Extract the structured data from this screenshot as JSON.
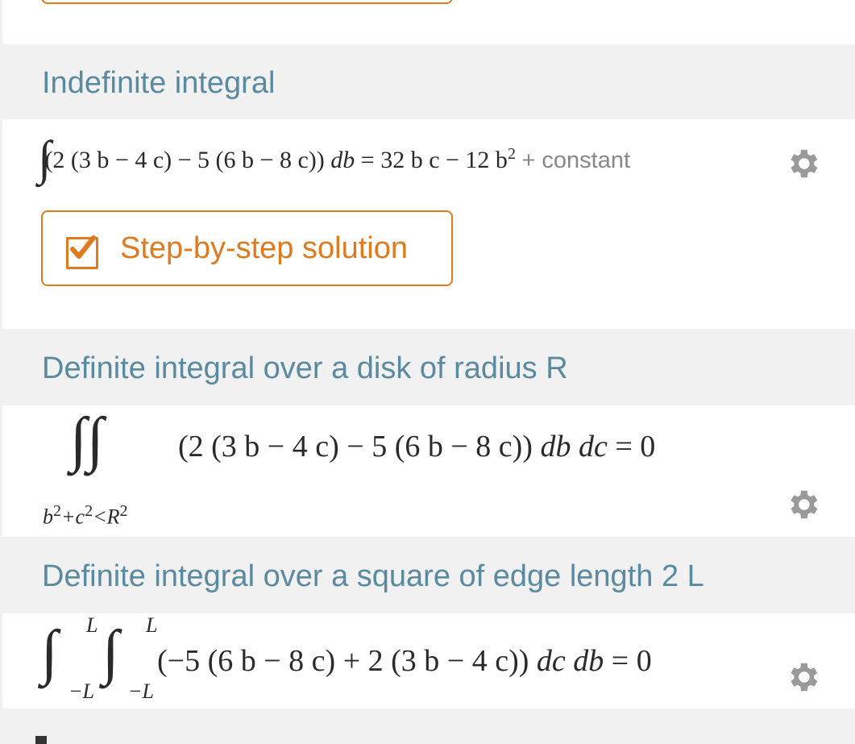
{
  "sections": {
    "indefinite": {
      "title": "Indefinite integral",
      "integrand": "(2 (3 b − 4 c) − 5 (6 b − 8 c))",
      "differential": "db",
      "result": "= 32 b c − 12 b",
      "result_exp": "2",
      "constant": "+ constant",
      "step_button": "Step-by-step solution"
    },
    "disk": {
      "title": "Definite integral over a disk of radius R",
      "expression": "(2 (3 b − 4 c) − 5 (6 b − 8 c))",
      "differentials": "db dc",
      "result": "= 0",
      "region_b": "b",
      "region_exp1": "2",
      "region_plus": "+c",
      "region_exp2": "2",
      "region_lt": "<R",
      "region_exp3": "2"
    },
    "square": {
      "title": "Definite integral over a square of edge length 2 L",
      "upper1": "L",
      "lower1": "−L",
      "upper2": "L",
      "lower2": "−L",
      "expression": "(−5 (6 b − 8 c) + 2 (3 b − 4 c))",
      "differentials": "dc db",
      "result": "= 0"
    }
  },
  "colors": {
    "title": "#5a8aa0",
    "accent": "#e07a1e",
    "gear": "#9a9a9a",
    "background": "#f1f1f1"
  }
}
